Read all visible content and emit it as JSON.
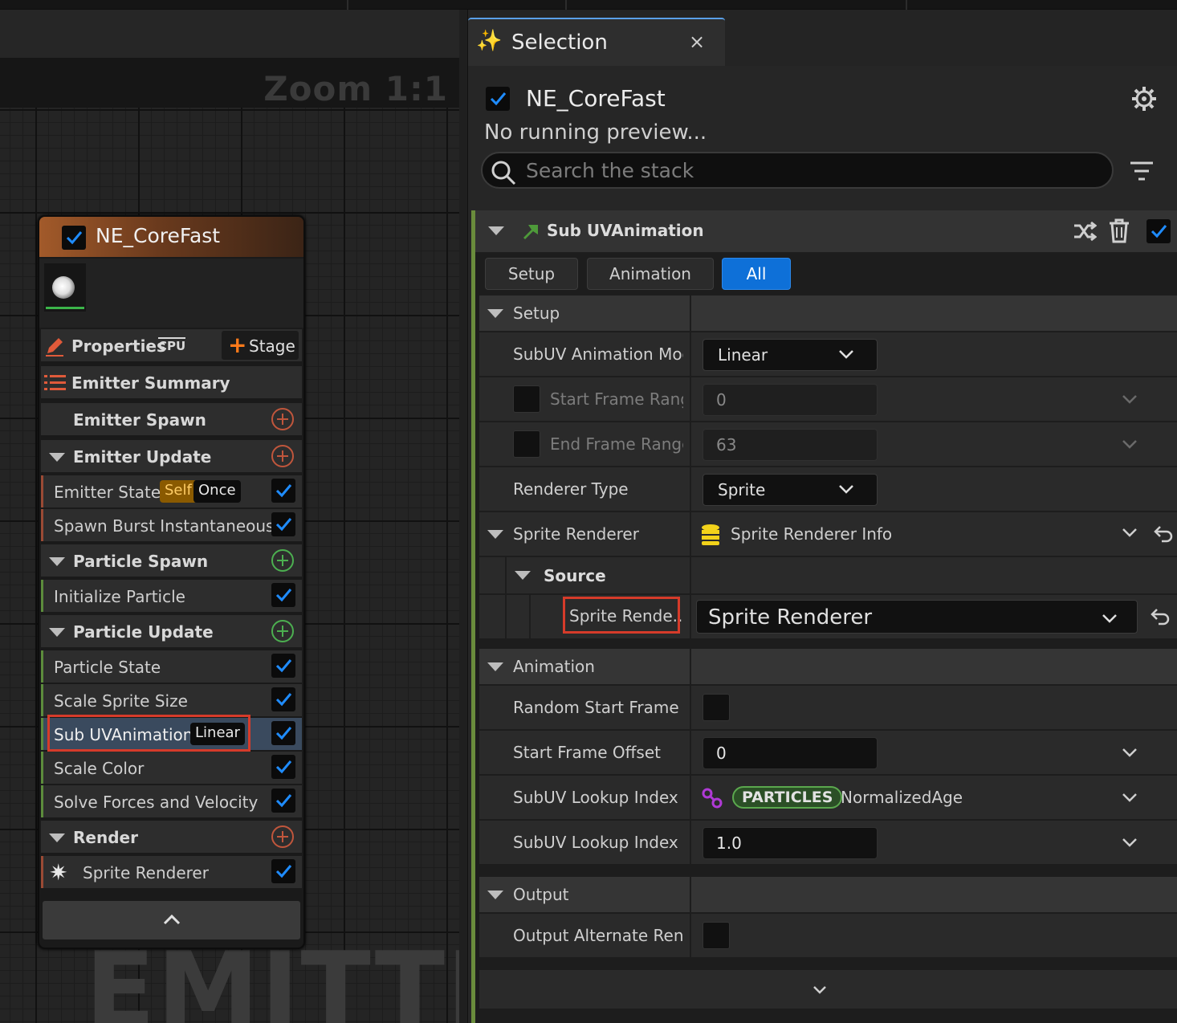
{
  "graph": {
    "zoom_label": "Zoom 1:1",
    "watermark": "EMITTER"
  },
  "node": {
    "title": "NE_CoreFast",
    "properties_label": "Properties",
    "cpu_label": "CPU",
    "stage_label": "Stage",
    "emitter_summary": "Emitter Summary",
    "emitter_spawn": "Emitter Spawn",
    "emitter_update": "Emitter Update",
    "emitter_state": "Emitter State",
    "emitter_state_tags": [
      "Self",
      "Once"
    ],
    "spawn_burst": "Spawn Burst Instantaneous",
    "particle_spawn": "Particle Spawn",
    "initialize_particle": "Initialize Particle",
    "particle_update": "Particle Update",
    "particle_state": "Particle State",
    "scale_sprite_size": "Scale Sprite Size",
    "sub_uv_animation": "Sub UVAnimation",
    "sub_uv_tag": "Linear",
    "scale_color": "Scale Color",
    "solve_forces": "Solve Forces and Velocity",
    "render": "Render",
    "sprite_renderer": "Sprite Renderer"
  },
  "panel": {
    "tab_title": "Selection",
    "tab_close": "×",
    "emitter_name": "NE_CoreFast",
    "status": "No running preview...",
    "search_placeholder": "Search the stack",
    "module_title": "Sub UVAnimation",
    "tabs": [
      "Setup",
      "Animation",
      "All"
    ],
    "active_tab": "All",
    "setup_cat": "Setup",
    "subuv_mode_label": "SubUV Animation Moc",
    "subuv_mode_value": "Linear",
    "start_range_label": "Start Frame Rang",
    "start_range_value": "0",
    "end_range_label": "End Frame Range",
    "end_range_value": "63",
    "renderer_type_label": "Renderer Type",
    "renderer_type_value": "Sprite",
    "sprite_renderer_label": "Sprite Renderer",
    "sprite_renderer_info": "Sprite Renderer Info",
    "source_label": "Source",
    "source_field_label": "Sprite Rende...",
    "source_field_value": "Sprite Renderer",
    "animation_cat": "Animation",
    "random_start_label": "Random Start Frame",
    "start_offset_label": "Start Frame Offset",
    "start_offset_value": "0",
    "lookup_index_label": "SubUV Lookup Index",
    "lookup_namespace": "PARTICLES",
    "lookup_attr": "NormalizedAge",
    "lookup_scale_label": "SubUV Lookup Index !",
    "lookup_scale_value": "1.0",
    "output_cat": "Output",
    "output_alt_label": "Output Alternate Rend"
  },
  "colors": {
    "accent_blue": "#0e70d8",
    "checkbox_blue": "#1f8cff",
    "emitter_orange": "#a25a2a",
    "module_green": "#6a8c3c",
    "highlight_red": "#d63b2a"
  }
}
